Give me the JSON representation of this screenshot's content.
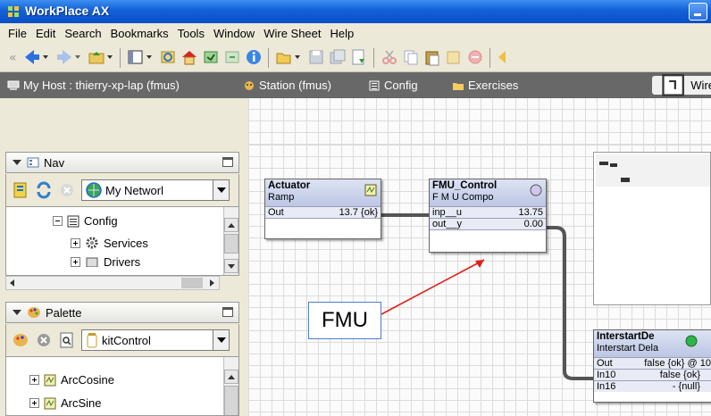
{
  "window": {
    "title": "WorkPlace AX"
  },
  "menu": [
    "File",
    "Edit",
    "Search",
    "Bookmarks",
    "Tools",
    "Window",
    "Wire Sheet",
    "Help"
  ],
  "locations": [
    {
      "label": "My Host : thierry-xp-lap (fmus)",
      "icon": "computer-icon"
    },
    {
      "label": "Station (fmus)",
      "icon": "station-icon"
    },
    {
      "label": "Config",
      "icon": "config-icon"
    },
    {
      "label": "Exercises",
      "icon": "folder-icon"
    },
    {
      "label": "Wire",
      "icon": "wiresheet-icon"
    }
  ],
  "nav": {
    "title": "Nav",
    "selector": "My Networl",
    "tree": [
      {
        "label": "Config",
        "icon": "config-icon"
      },
      {
        "label": "Services",
        "icon": "gear-icon"
      },
      {
        "label": "Drivers",
        "icon": "drivers-icon"
      }
    ]
  },
  "palette": {
    "title": "Palette",
    "selector": "kitControl",
    "tree": [
      {
        "label": "ArcCosine",
        "icon": "math-icon"
      },
      {
        "label": "ArcSine",
        "icon": "math-icon"
      }
    ]
  },
  "blocks": {
    "actuator": {
      "name": "Actuator",
      "type": "Ramp",
      "slots": [
        {
          "name": "Out",
          "value": "13.7 {ok}"
        }
      ]
    },
    "fmu": {
      "name": "FMU_Control",
      "type": "F M U Compo",
      "slots": [
        {
          "name": "inp__u",
          "value": "13.75"
        },
        {
          "name": "out__y",
          "value": "0.00"
        }
      ]
    },
    "interstart": {
      "name": "InterstartDe",
      "type": "Interstart Dela",
      "slots": [
        {
          "name": "Out",
          "value": "false {ok} @ 10"
        },
        {
          "name": "In10",
          "value": "false {ok}"
        },
        {
          "name": "In16",
          "value": "- {null}"
        }
      ]
    }
  },
  "callout": {
    "text": "FMU"
  },
  "colors": {
    "title_bar": "#0a4fc6",
    "wire": "#555555",
    "arrow": "#e0201a",
    "location_bar": "#686868"
  }
}
